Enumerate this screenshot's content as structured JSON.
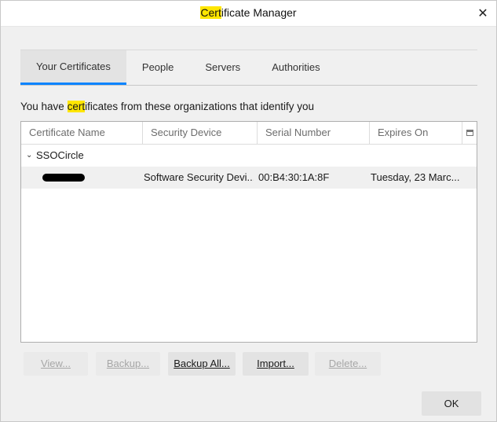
{
  "window": {
    "title_highlight": "Cert",
    "title_rest": "ificate Manager",
    "close_glyph": "✕"
  },
  "tabs": [
    {
      "label": "Your Certificates",
      "active": true
    },
    {
      "label": "People",
      "active": false
    },
    {
      "label": "Servers",
      "active": false
    },
    {
      "label": "Authorities",
      "active": false
    }
  ],
  "description": {
    "before": "You have ",
    "highlight": "cert",
    "after": "ificates from these organizations that identify you"
  },
  "table": {
    "columns": [
      "Certificate Name",
      "Security Device",
      "Serial Number",
      "Expires On"
    ],
    "groups": [
      {
        "name": "SSOCircle",
        "expanded": true,
        "rows": [
          {
            "certificate_name": "",
            "security_device": "Software Security Devi...",
            "serial_number": "00:B4:30:1A:8F",
            "expires_on": "Tuesday, 23 Marc..."
          }
        ]
      }
    ]
  },
  "buttons": {
    "view": "View...",
    "backup": "Backup...",
    "backup_all": "Backup All...",
    "import": "Import...",
    "delete": "Delete...",
    "ok": "OK"
  },
  "icons": {
    "close": "close-icon",
    "twisty": "chevron-down-icon",
    "column_picker": "column-picker-icon"
  },
  "colors": {
    "accent": "#0a84ff",
    "highlight": "#ffe600"
  }
}
